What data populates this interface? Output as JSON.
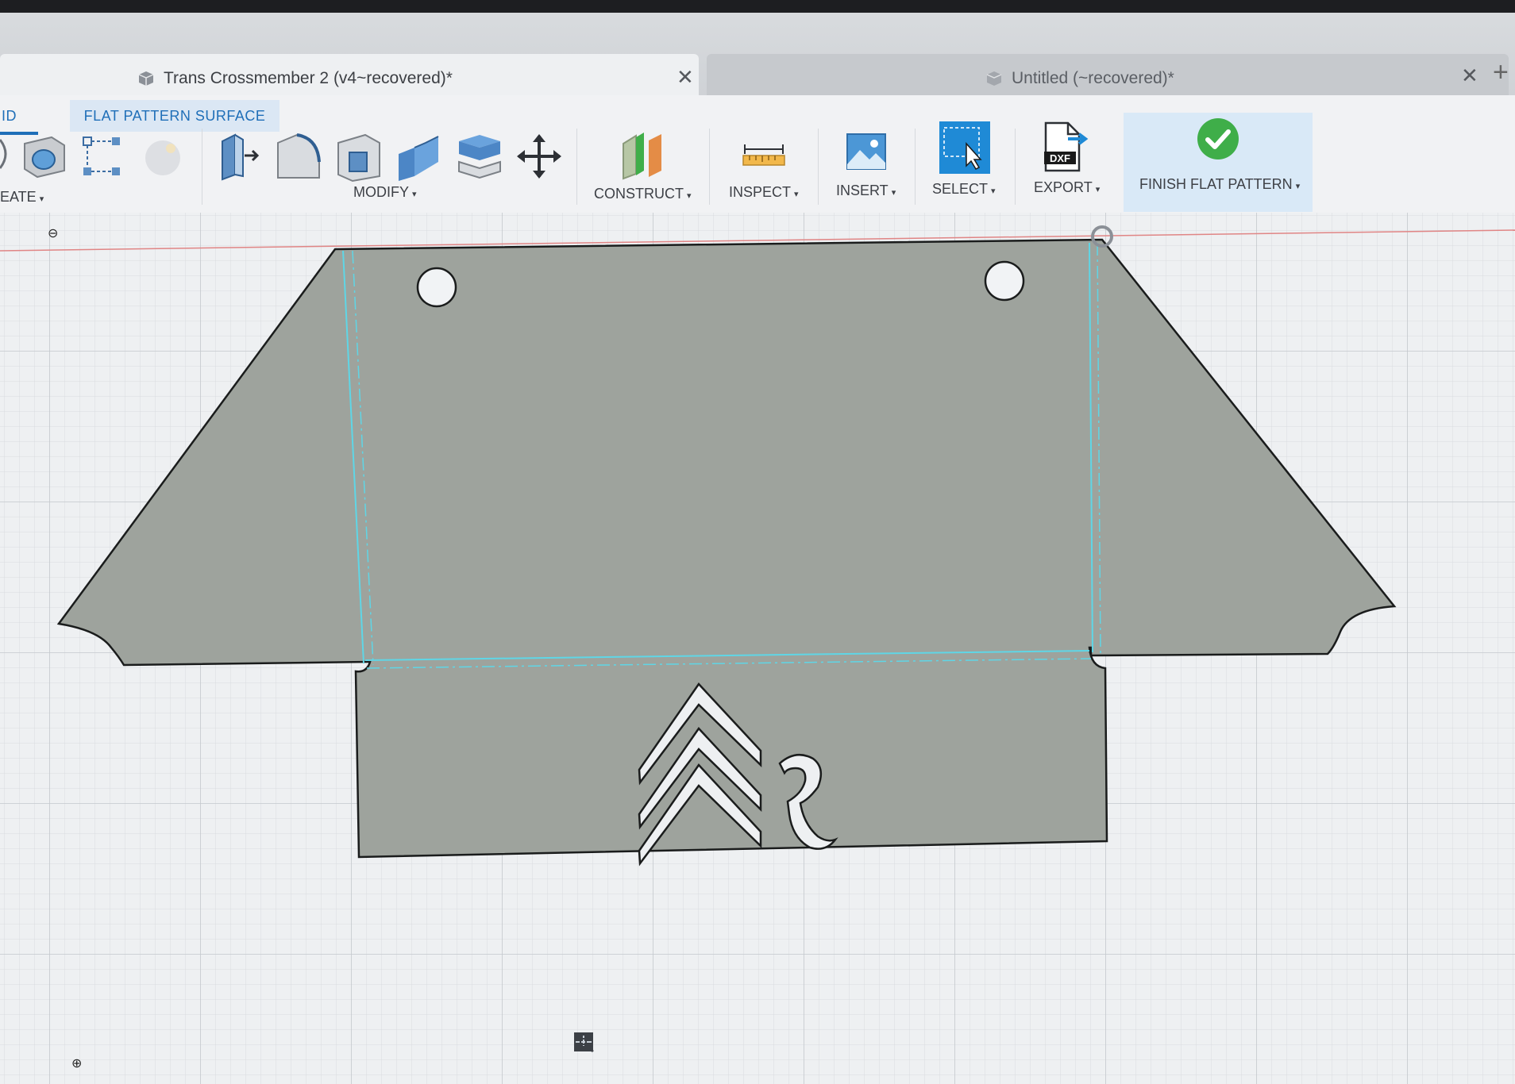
{
  "tabs": {
    "active_title": "Trans Crossmember 2 (v4~recovered)*",
    "inactive_title": "Untitled (~recovered)*",
    "close_glyph": "✕",
    "new_tab_glyph": "+"
  },
  "ribbon": {
    "mode_tab_solid": "ID",
    "mode_tab_flat": "FLAT PATTERN SURFACE",
    "groups": {
      "create": "EATE",
      "modify": "MODIFY",
      "construct": "CONSTRUCT",
      "inspect": "INSPECT",
      "insert": "INSERT",
      "select": "SELECT",
      "export": "EXPORT",
      "finish": "FINISH FLAT PATTERN"
    },
    "export_icon_text": "DXF",
    "caret": "▾"
  },
  "browser": {
    "collapse_glyph": "⊖",
    "expand_glyph": "⊕"
  },
  "navbar": {
    "icons": [
      "orbit-icon",
      "look-at-icon",
      "pan-icon",
      "zoom-icon",
      "fit-icon",
      "display-settings-icon",
      "grid-settings-icon",
      "viewports-icon"
    ]
  },
  "colors": {
    "part_fill": "#9ea39d",
    "bend_line": "#5fd6e6",
    "grid_line": "#cfd3d8",
    "accent_blue": "#1f6fb8",
    "finish_green": "#3fae49"
  }
}
